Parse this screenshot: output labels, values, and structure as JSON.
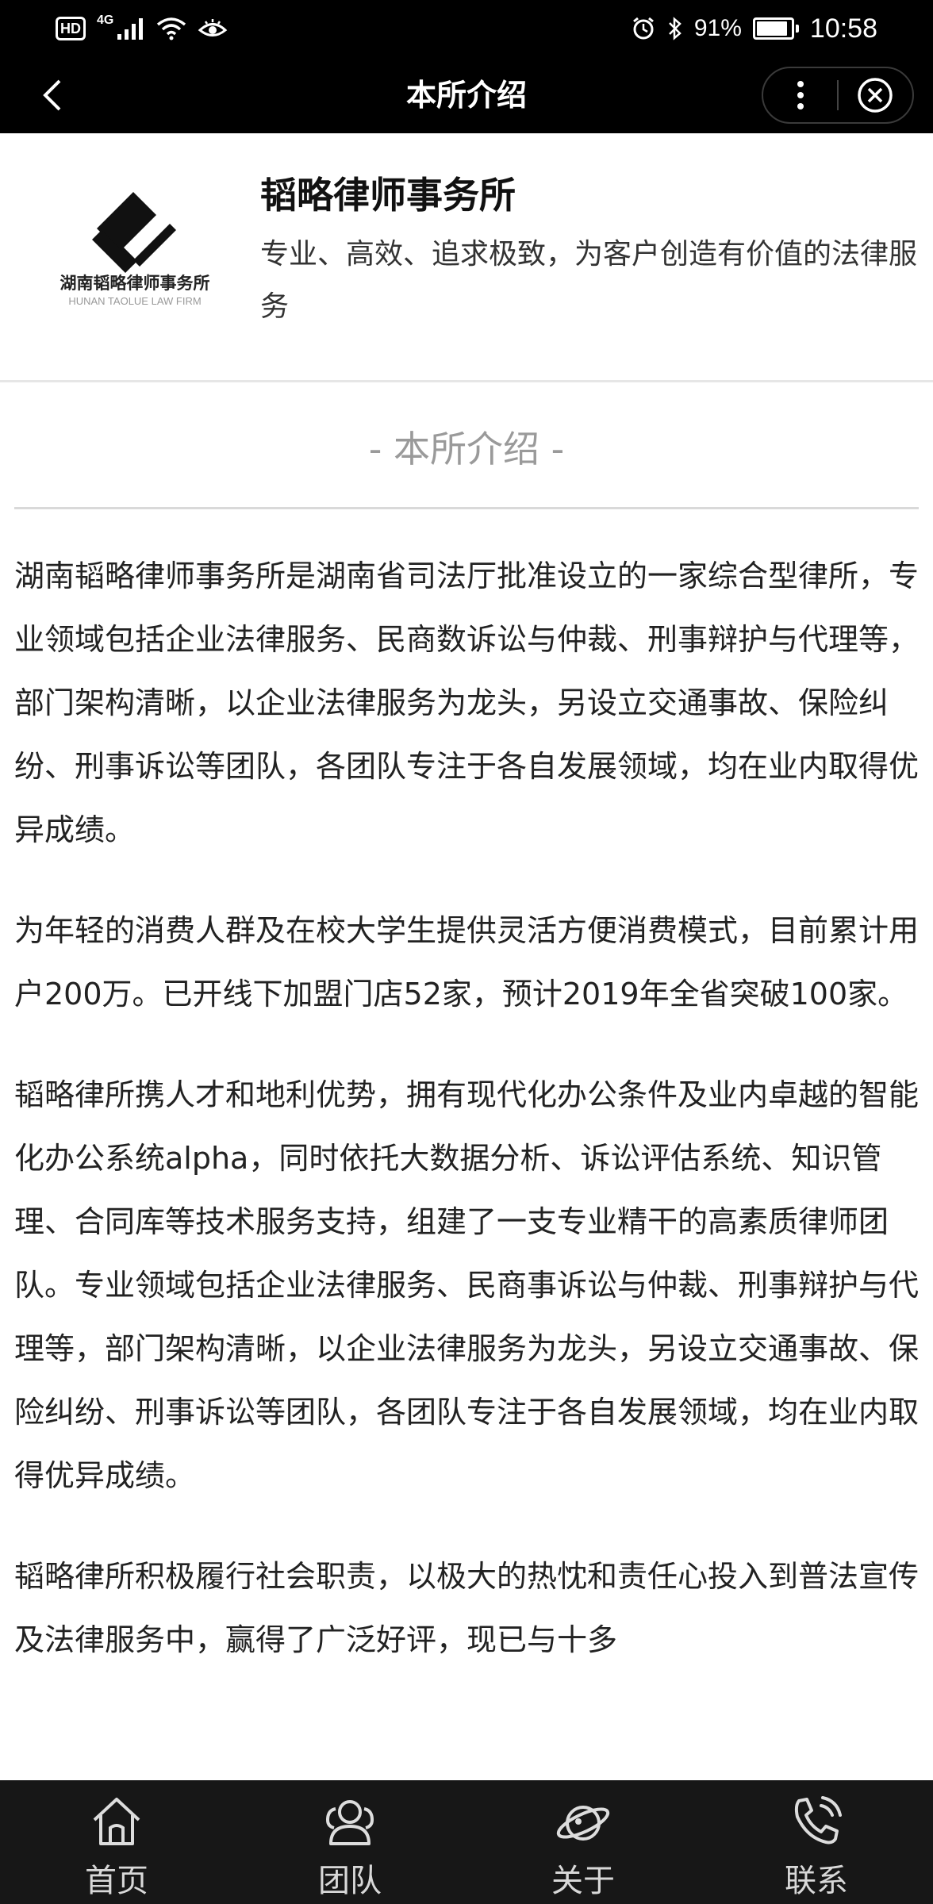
{
  "status_bar": {
    "hd": "HD",
    "network": "4G",
    "battery_percent": "91%",
    "battery_level": 0.91,
    "time": "10:58"
  },
  "nav": {
    "title": "本所介绍"
  },
  "firm": {
    "logo_text": "湖南韬略律师事务所",
    "logo_subtext": "HUNAN TAOLUE LAW FIRM",
    "name": "韬略律师事务所",
    "slogan": "专业、高效、追求极致，为客户创造有价值的法律服务"
  },
  "section": {
    "title": "- 本所介绍 -"
  },
  "article": {
    "paragraphs": [
      "湖南韬略律师事务所是湖南省司法厅批准设立的一家综合型律所，专业领域包括企业法律服务、民商数诉讼与仲裁、刑事辩护与代理等，部门架构清晰，以企业法律服务为龙头，另设立交通事故、保险纠纷、刑事诉讼等团队，各团队专注于各自发展领域，均在业内取得优异成绩。",
      "为年轻的消费人群及在校大学生提供灵活方便消费模式，目前累计用户200万。已开线下加盟门店52家，预计2019年全省突破100家。",
      "韬略律所携人才和地利优势，拥有现代化办公条件及业内卓越的智能化办公系统alpha，同时依托大数据分析、诉讼评估系统、知识管理、合同库等技术服务支持，组建了一支专业精干的高素质律师团队。专业领域包括企业法律服务、民商事诉讼与仲裁、刑事辩护与代理等，部门架构清晰，以企业法律服务为龙头，另设立交通事故、保险纠纷、刑事诉讼等团队，各团队专注于各自发展领域，均在业内取得优异成绩。",
      "韬略律所积极履行社会职责，以极大的热忱和责任心投入到普法宣传及法律服务中，赢得了广泛好评，现已与十多"
    ]
  },
  "tabbar": {
    "items": [
      {
        "label": "首页",
        "icon": "home-icon"
      },
      {
        "label": "团队",
        "icon": "team-icon"
      },
      {
        "label": "关于",
        "icon": "planet-icon"
      },
      {
        "label": "联系",
        "icon": "phone-icon"
      }
    ]
  }
}
